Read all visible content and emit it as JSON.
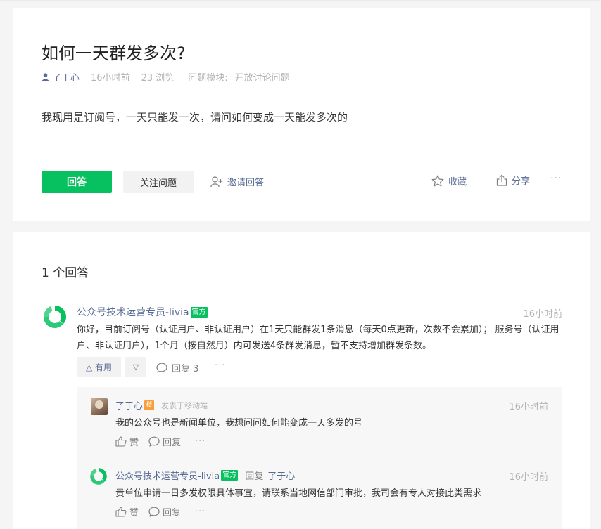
{
  "question": {
    "title": "如何一天群发多次?",
    "author": "了于心",
    "time": "16小时前",
    "views": "23 浏览",
    "module_label": "问题模块:",
    "module_value": "开放讨论问题",
    "body": "我现用是订阅号，一天只能发一次，请问如何变成一天能发多次的",
    "answer_button": "回答",
    "follow_button": "关注问题",
    "invite_button": "邀请回答",
    "collect_button": "收藏",
    "share_button": "分享",
    "more_dots": "···"
  },
  "answers": {
    "count_label": "1 个回答",
    "items": [
      {
        "author": "公众号技术运营专员-livia",
        "badge": "官方",
        "time": "16小时前",
        "text": "你好，目前订阅号（认证用户、非认证用户）在1天只能群发1条消息（每天0点更新，次数不会累加）；  服务号（认证用户、非认证用户），1个月（按自然月）内可发送4条群发消息，暂不支持增加群发条数。",
        "useful_label": "△ 有用",
        "downvote_label": "▽",
        "reply_label": "回复 3",
        "more_dots": "···"
      }
    ]
  },
  "comments": [
    {
      "author": "了于心",
      "badge": "楼",
      "source": "发表于移动端",
      "time": "16小时前",
      "text": "我的公众号也是新闻单位，我想问问如何能变成一天多发的号",
      "like_label": "赞",
      "reply_label": "回复",
      "more_dots": "···"
    },
    {
      "author": "公众号技术运营专员-livia",
      "badge": "官方",
      "reply_word": "回复",
      "reply_target": "了于心",
      "time": "16小时前",
      "text": "贵单位申请一日多发权限具体事宜，请联系当地网信部门审批，我司会有专人对接此类需求",
      "like_label": "赞",
      "reply_label": "回复",
      "more_dots": "···"
    }
  ],
  "colors": {
    "brand_green": "#07c160",
    "link_blue": "#576b95",
    "muted_gray": "#b2b2b2",
    "user_badge_orange": "#fa9d3b"
  }
}
